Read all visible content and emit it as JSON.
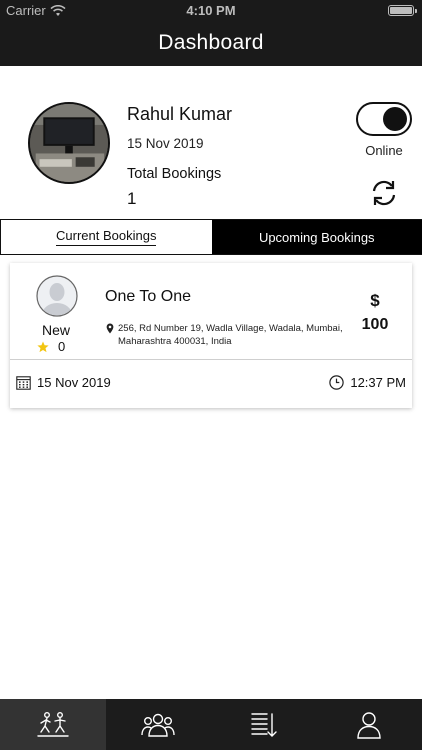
{
  "status_bar": {
    "carrier": "Carrier",
    "time": "4:10 PM"
  },
  "header": {
    "title": "Dashboard"
  },
  "profile": {
    "name": "Rahul Kumar",
    "date": "15 Nov 2019",
    "total_bookings_label": "Total Bookings",
    "total_bookings": "1",
    "online_label": "Online",
    "online": true
  },
  "tabs": [
    {
      "label": "Current Bookings",
      "active": true
    },
    {
      "label": "Upcoming Bookings",
      "active": false
    }
  ],
  "bookings": [
    {
      "user_status": "New",
      "rating": "0",
      "service": "One To One",
      "address": "256, Rd Number 19, Wadla Village, Wadala, Mumbai, Maharashtra 400031, India",
      "currency": "$",
      "price": "100",
      "date": "15 Nov 2019",
      "time": "12:37 PM"
    }
  ],
  "nav": [
    "workout-icon",
    "group-icon",
    "list-sort-icon",
    "profile-icon"
  ],
  "colors": {
    "header_bg": "#1a1a1a",
    "accent_black": "#000000",
    "star": "#f2c511",
    "nav_active": "#333333"
  }
}
